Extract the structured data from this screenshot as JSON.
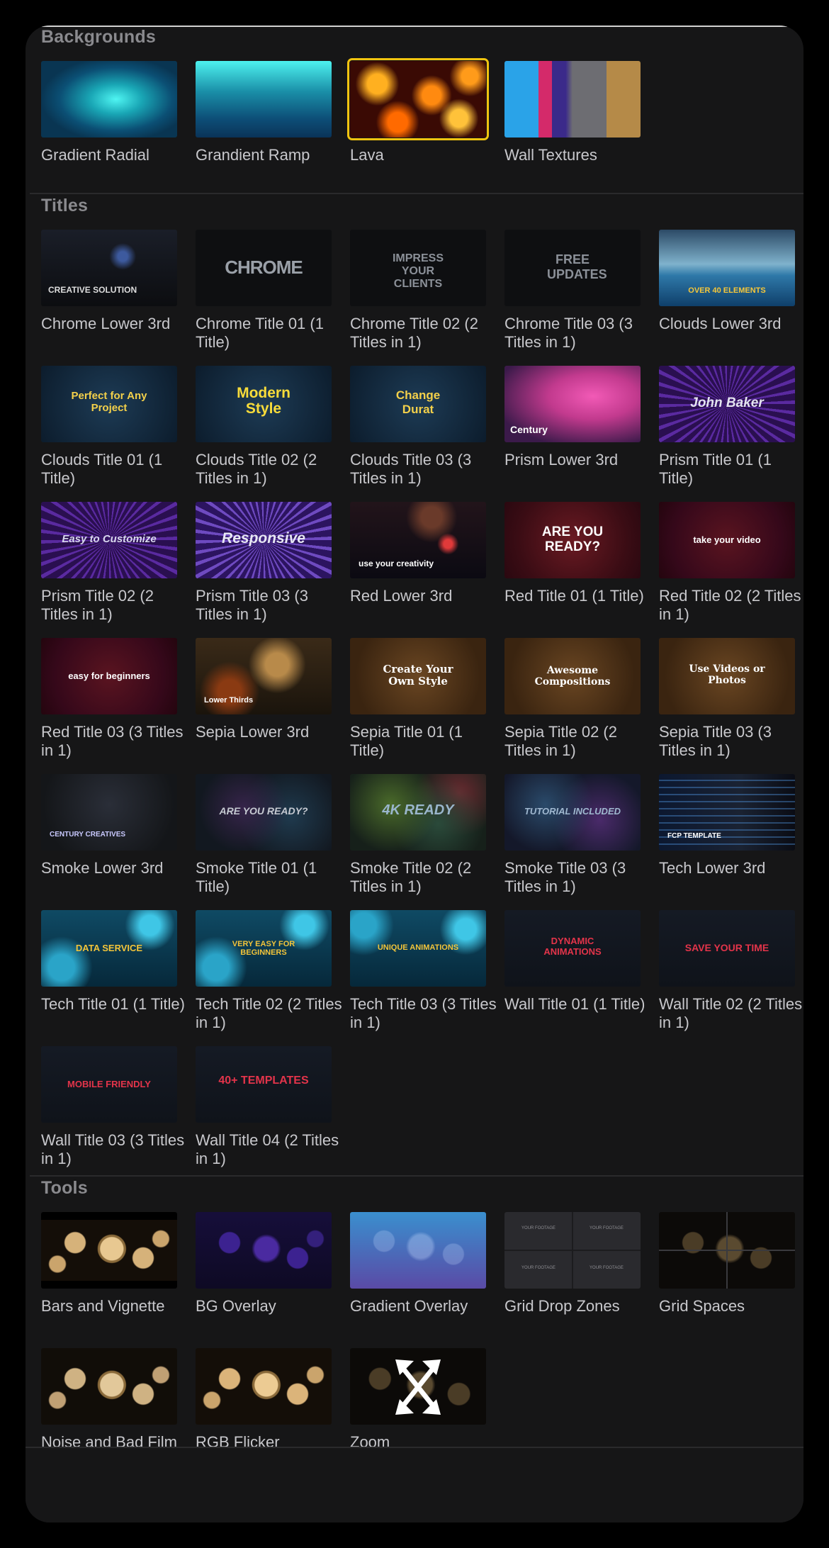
{
  "sections": {
    "backgrounds": "Backgrounds",
    "titles": "Titles",
    "tools": "Tools"
  },
  "backgrounds": [
    {
      "label": "Gradient Radial",
      "selected": false
    },
    {
      "label": "Grandient Ramp",
      "selected": false
    },
    {
      "label": "Lava",
      "selected": true
    },
    {
      "label": "Wall Textures",
      "selected": false
    }
  ],
  "titles": [
    {
      "label": "Chrome Lower 3rd",
      "thumb_text": "CREATIVE SOLUTION"
    },
    {
      "label": "Chrome Title 01 (1 Title)",
      "thumb_text": "CHROME"
    },
    {
      "label": "Chrome Title 02 (2 Titles in 1)",
      "thumb_text": "IMPRESS YOUR CLIENTS"
    },
    {
      "label": "Chrome Title 03 (3 Titles in 1)",
      "thumb_text": "FREE UPDATES"
    },
    {
      "label": "Clouds Lower 3rd",
      "thumb_text": "OVER 40 ELEMENTS"
    },
    {
      "label": "Clouds Title 01 (1 Title)",
      "thumb_text": "Perfect for Any Project"
    },
    {
      "label": "Clouds Title 02 (2 Titles in 1)",
      "thumb_text": "Modern Style"
    },
    {
      "label": "Clouds Title 03 (3 Titles in 1)",
      "thumb_text": "Change Durat"
    },
    {
      "label": "Prism Lower 3rd",
      "thumb_text": "Century"
    },
    {
      "label": "Prism Title 01 (1 Title)",
      "thumb_text": "John Baker"
    },
    {
      "label": "Prism Title 02 (2 Titles in 1)",
      "thumb_text": "Easy to Customize"
    },
    {
      "label": "Prism Title 03 (3 Titles in 1)",
      "thumb_text": "Responsive"
    },
    {
      "label": "Red Lower 3rd",
      "thumb_text": "use your creativity"
    },
    {
      "label": "Red Title 01 (1 Title)",
      "thumb_text": "ARE YOU READY?"
    },
    {
      "label": "Red Title 02 (2 Titles in 1)",
      "thumb_text": "take your video"
    },
    {
      "label": "Red Title 03 (3 Titles in 1)",
      "thumb_text": "easy for beginners"
    },
    {
      "label": "Sepia Lower 3rd",
      "thumb_text": "Lower Thirds"
    },
    {
      "label": "Sepia Title 01 (1 Title)",
      "thumb_text": "Create Your Own Style"
    },
    {
      "label": "Sepia Title 02 (2 Titles in 1)",
      "thumb_text": "Awesome Compositions"
    },
    {
      "label": "Sepia Title 03 (3 Titles in 1)",
      "thumb_text": "Use Videos or Photos"
    },
    {
      "label": "Smoke Lower 3rd",
      "thumb_text": "CENTURY CREATIVES"
    },
    {
      "label": "Smoke Title 01 (1 Title)",
      "thumb_text": "ARE YOU READY?"
    },
    {
      "label": "Smoke Title 02 (2 Titles in 1)",
      "thumb_text": "4K READY"
    },
    {
      "label": "Smoke Title 03 (3 Titles in 1)",
      "thumb_text": "TUTORIAL INCLUDED"
    },
    {
      "label": "Tech Lower 3rd",
      "thumb_text": "FCP TEMPLATE"
    },
    {
      "label": "Tech Title 01 (1 Title)",
      "thumb_text": "DATA SERVICE"
    },
    {
      "label": "Tech Title 02 (2 Titles in 1)",
      "thumb_text": "VERY EASY FOR BEGINNERS"
    },
    {
      "label": "Tech Title 03 (3 Titles in 1)",
      "thumb_text": "UNIQUE ANIMATIONS"
    },
    {
      "label": "Wall Title 01 (1 Title)",
      "thumb_text": "DYNAMIC ANIMATIONS"
    },
    {
      "label": "Wall Title 02 (2 Titles in 1)",
      "thumb_text": "SAVE YOUR TIME"
    },
    {
      "label": "Wall Title 03 (3 Titles in 1)",
      "thumb_text": "MOBILE FRIENDLY"
    },
    {
      "label": "Wall Title 04 (2 Titles in 1)",
      "thumb_text": "40+ TEMPLATES"
    }
  ],
  "tools": [
    {
      "label": "Bars and Vignette"
    },
    {
      "label": "BG Overlay"
    },
    {
      "label": "Gradient Overlay"
    },
    {
      "label": "Grid Drop Zones",
      "thumb_text": "YOUR FOOTAGE"
    },
    {
      "label": "Grid Spaces"
    },
    {
      "label": "Noise and Bad Film"
    },
    {
      "label": "RGB Flicker"
    },
    {
      "label": "Zoom"
    }
  ],
  "colors": {
    "selection": "#f1c40f",
    "panel": "#161617",
    "label": "#c8c8cc",
    "section_header": "#8a8a8e"
  }
}
